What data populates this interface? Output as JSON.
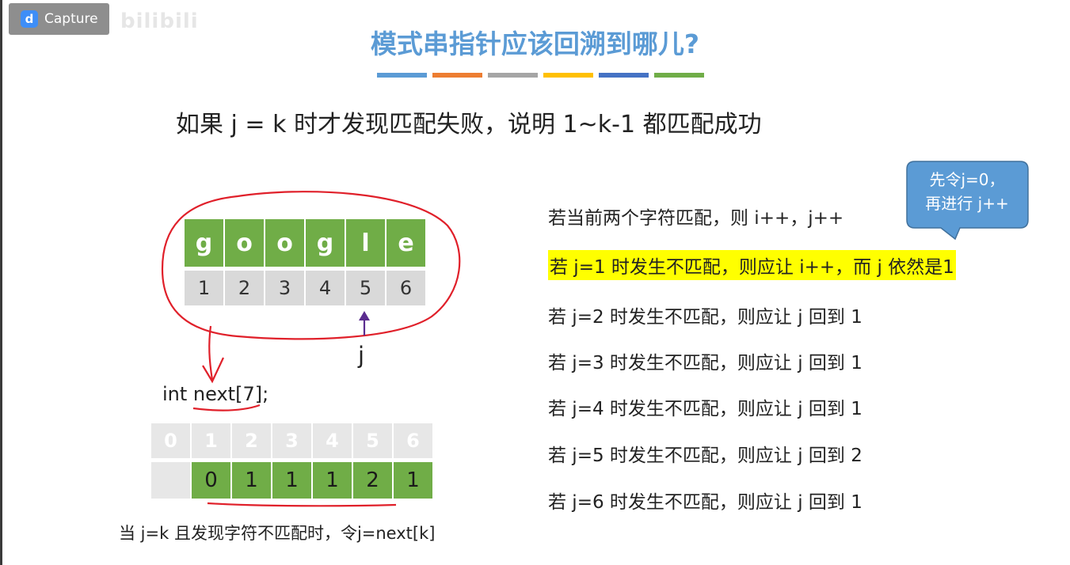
{
  "badge": {
    "logo_letter": "d",
    "label": "Capture"
  },
  "watermark": "bilibili",
  "title": "模式串指针应该回溯到哪儿?",
  "color_bars": [
    "#5b9bd5",
    "#ed7d31",
    "#a5a5a5",
    "#ffc000",
    "#4472c4",
    "#70ad47"
  ],
  "subtitle": "如果 j = k 时才发现匹配失败，说明 1~k-1 都匹配成功",
  "pattern": {
    "chars": [
      "g",
      "o",
      "o",
      "g",
      "l",
      "e"
    ],
    "indices": [
      "1",
      "2",
      "3",
      "4",
      "5",
      "6"
    ],
    "pointer_label": "j"
  },
  "code_line": "int next[7];",
  "next_table": {
    "indices": [
      "0",
      "1",
      "2",
      "3",
      "4",
      "5",
      "6"
    ],
    "values": [
      "",
      "0",
      "1",
      "1",
      "1",
      "2",
      "1"
    ]
  },
  "caption": "当 j=k 且发现字符不匹配时，令j=next[k]",
  "rules": [
    "若当前两个字符匹配，则 i++，j++",
    "若 j=1 时发生不匹配，则应让 i++，而 j 依然是1",
    "若 j=2 时发生不匹配，则应让 j 回到 1",
    "若 j=3 时发生不匹配，则应让 j 回到 1",
    "若 j=4 时发生不匹配，则应让 j 回到 1",
    "若 j=5 时发生不匹配，则应让 j 回到 2",
    "若 j=6 时发生不匹配，则应让 j 回到 1"
  ],
  "callout": {
    "line1": "先令j=0，",
    "line2": "再进行 j++"
  },
  "colors": {
    "title": "#5b9bd5",
    "green": "#70ad47",
    "annotation_red": "#e0202a",
    "highlight": "#ffff00",
    "callout": "#5b9bd5",
    "arrow": "#5b2c8f"
  }
}
